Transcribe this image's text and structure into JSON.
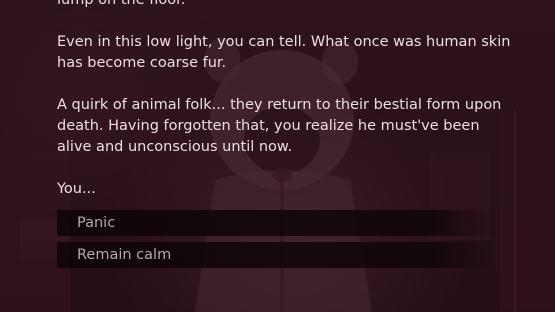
{
  "story": {
    "paragraph_0": "lump on the floor.",
    "paragraph_1": "Even in this low light, you can tell. What once was human skin has become coarse fur.",
    "paragraph_2": "A quirk of animal folk... they return to their bestial form upon death. Having forgotten that, you realize he must've been alive and unconscious until now.",
    "prompt": "You..."
  },
  "choices": [
    {
      "label": "Panic"
    },
    {
      "label": "Remain calm"
    }
  ],
  "colors": {
    "text": "#ecdfe2",
    "choice_text": "#b8a6aa",
    "background": "#2a1419"
  }
}
